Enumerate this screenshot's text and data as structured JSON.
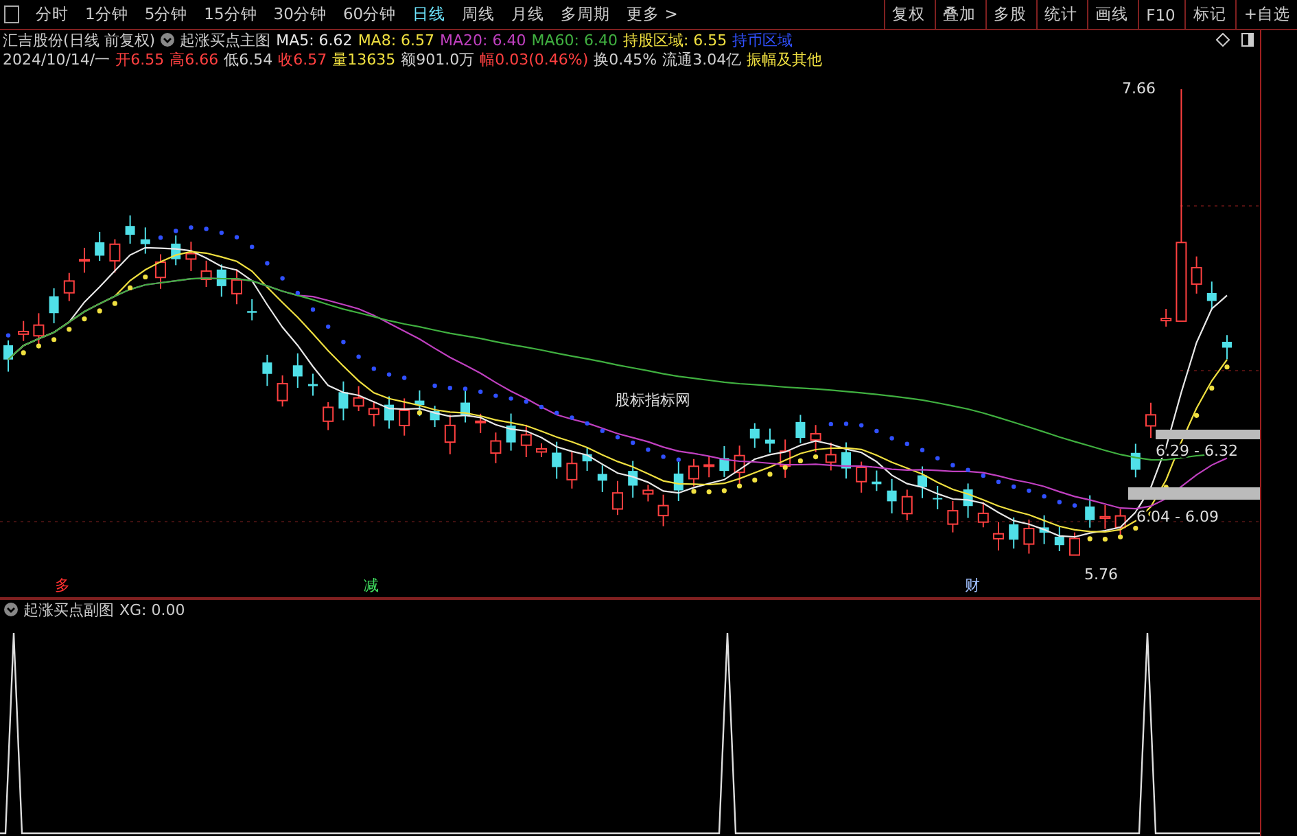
{
  "toolbar": {
    "periods": [
      {
        "label": "分时",
        "selected": false
      },
      {
        "label": "1分钟",
        "selected": false
      },
      {
        "label": "5分钟",
        "selected": false
      },
      {
        "label": "15分钟",
        "selected": false
      },
      {
        "label": "30分钟",
        "selected": false
      },
      {
        "label": "60分钟",
        "selected": false
      },
      {
        "label": "日线",
        "selected": true
      },
      {
        "label": "周线",
        "selected": false
      },
      {
        "label": "月线",
        "selected": false
      },
      {
        "label": "多周期",
        "selected": false
      },
      {
        "label": "更多 >",
        "selected": false
      }
    ],
    "tools": [
      "复权",
      "叠加",
      "多股",
      "统计",
      "画线",
      "F10",
      "标记",
      "+自选"
    ]
  },
  "main_chart": {
    "title": "汇吉股份(日线 前复权)",
    "indicator": "起涨买点主图",
    "legend": [
      {
        "label": "MA5: 6.62",
        "color": "#e8e8e8"
      },
      {
        "label": "MA8: 6.57",
        "color": "#f0e040"
      },
      {
        "label": "MA20: 6.40",
        "color": "#c040c0"
      },
      {
        "label": "MA60: 6.40",
        "color": "#40b040"
      },
      {
        "label": "持股区域: 6.55",
        "color": "#f0e040"
      },
      {
        "label": "持币区域",
        "color": "#3050ff"
      }
    ],
    "quote": [
      {
        "label": "2024/10/14/一",
        "color": "#d0d0d0"
      },
      {
        "label": "开6.55",
        "color": "#ff4040"
      },
      {
        "label": "高6.66",
        "color": "#ff4040"
      },
      {
        "label": "低6.54",
        "color": "#d0d0d0"
      },
      {
        "label": "收6.57",
        "color": "#ff4040"
      },
      {
        "label": "量13635",
        "color": "#f0e040"
      },
      {
        "label": "额901.0万",
        "color": "#d0d0d0"
      },
      {
        "label": "幅0.03(0.46%)",
        "color": "#ff4040"
      },
      {
        "label": "换0.45%",
        "color": "#d0d0d0"
      },
      {
        "label": "流通3.04亿",
        "color": "#d0d0d0"
      },
      {
        "label": "振幅及其他",
        "color": "#f0e040"
      }
    ],
    "annotations": [
      "7.66",
      "股标指标网",
      "6.29 - 6.32",
      "6.04 - 6.09",
      "5.76"
    ],
    "markers": [
      {
        "label": "多",
        "color": "#ff3030"
      },
      {
        "label": "减",
        "color": "#40e060"
      },
      {
        "label": "财",
        "color": "#a0c0ff"
      }
    ]
  },
  "sub_chart": {
    "indicator": "起涨买点副图",
    "reading": "XG: 0.00"
  }
}
